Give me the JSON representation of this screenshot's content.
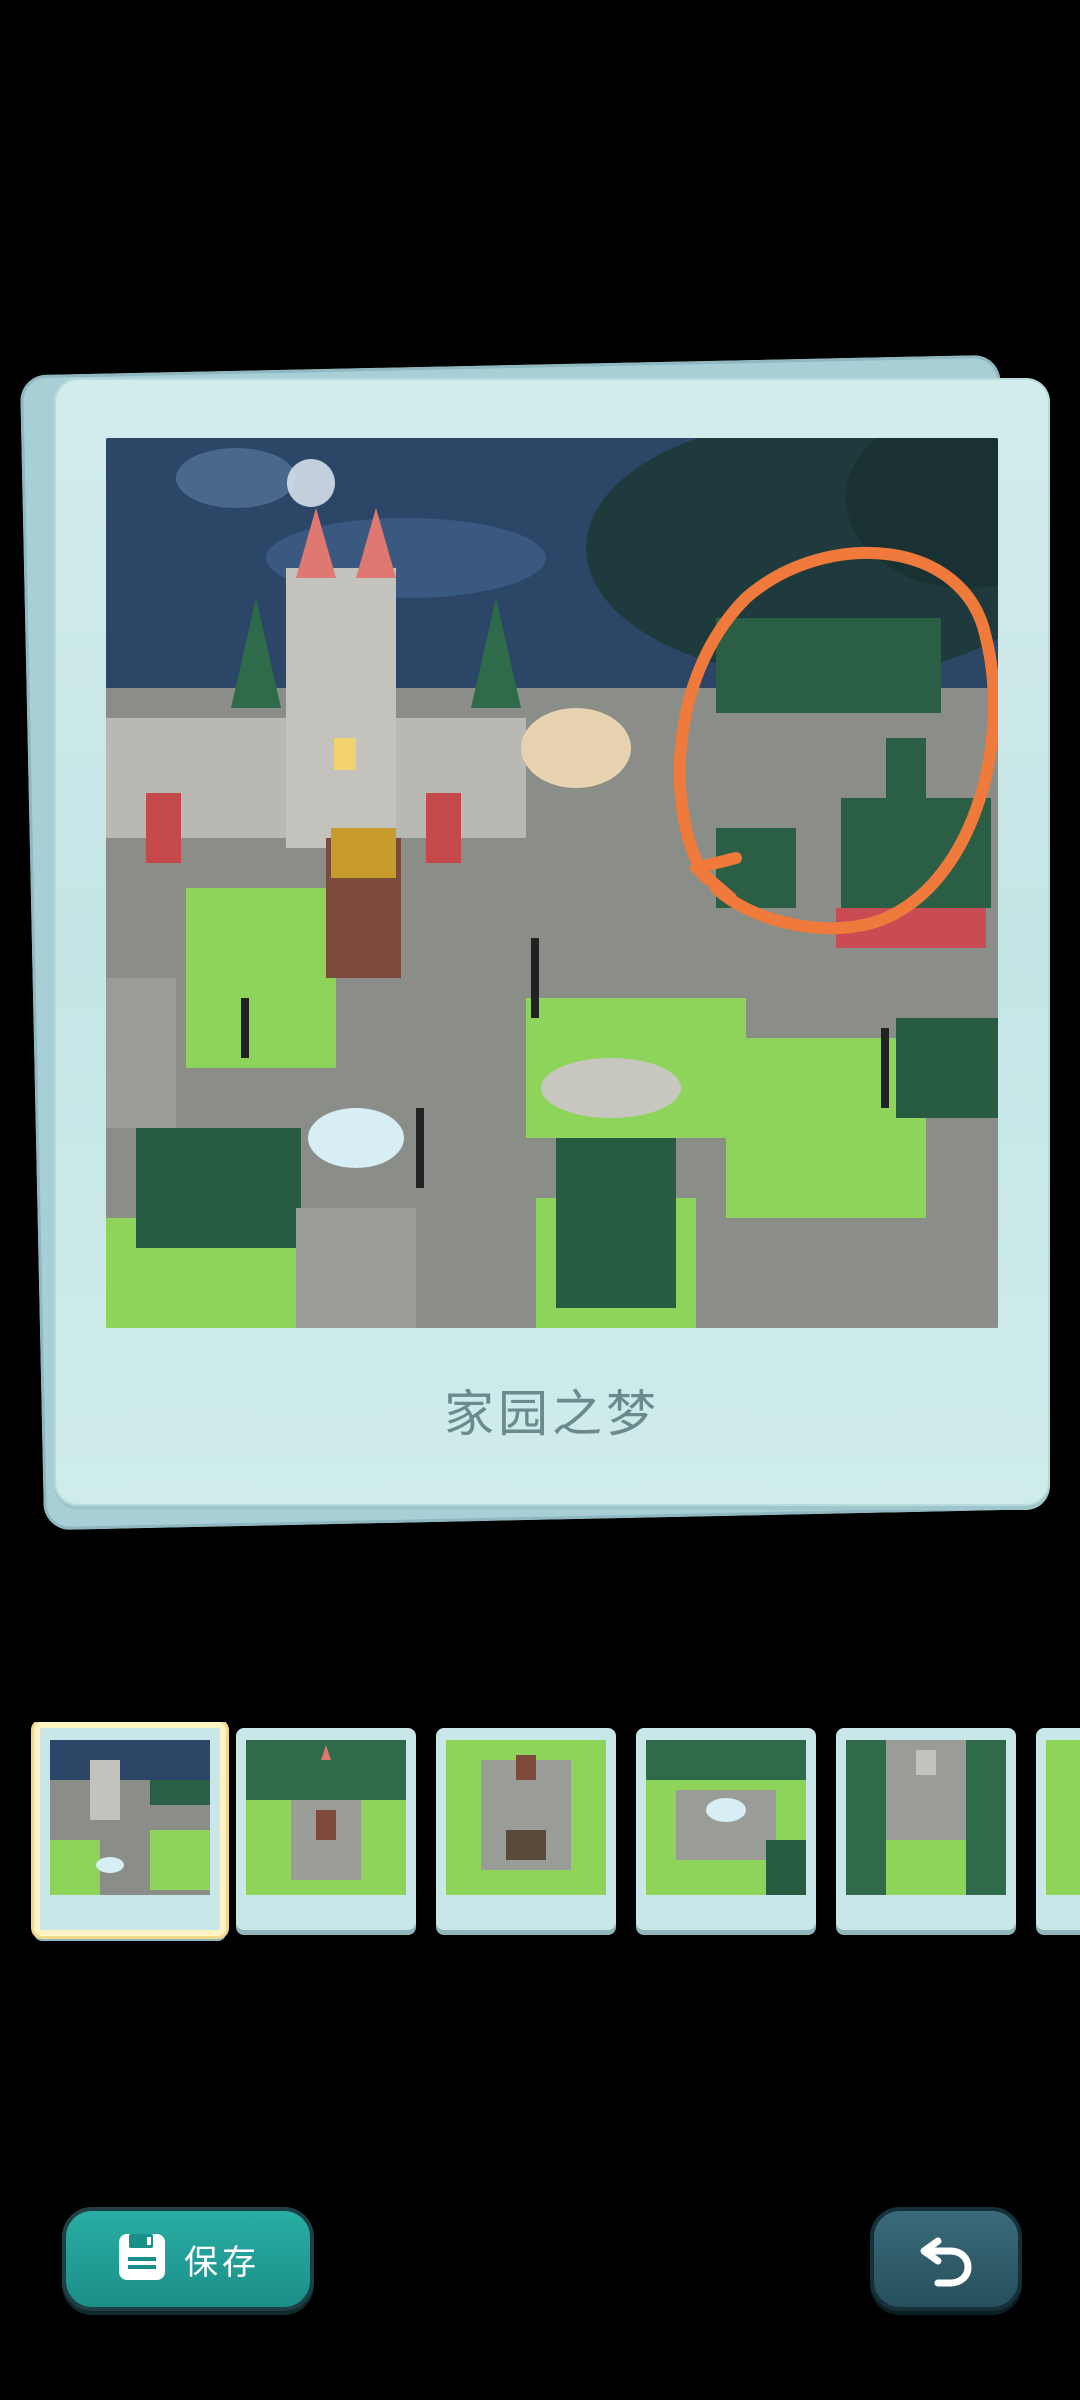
{
  "card": {
    "caption": "家园之梦"
  },
  "thumbnails": [
    {
      "id": "thumb-1",
      "selected": true
    },
    {
      "id": "thumb-2",
      "selected": false
    },
    {
      "id": "thumb-3",
      "selected": false
    },
    {
      "id": "thumb-4",
      "selected": false
    },
    {
      "id": "thumb-5",
      "selected": false
    }
  ],
  "buttons": {
    "save_label": "保存",
    "save_icon": "floppy-disk-icon",
    "back_icon": "undo-arrow-icon"
  },
  "colors": {
    "background": "#000000",
    "card": "#c5e5e6",
    "caption": "#6b8a8e",
    "save_button": "#1a8f88",
    "back_button": "#274f5c",
    "highlight_circle": "#f07a3c",
    "selected_thumb_border": "#fff3c4"
  }
}
